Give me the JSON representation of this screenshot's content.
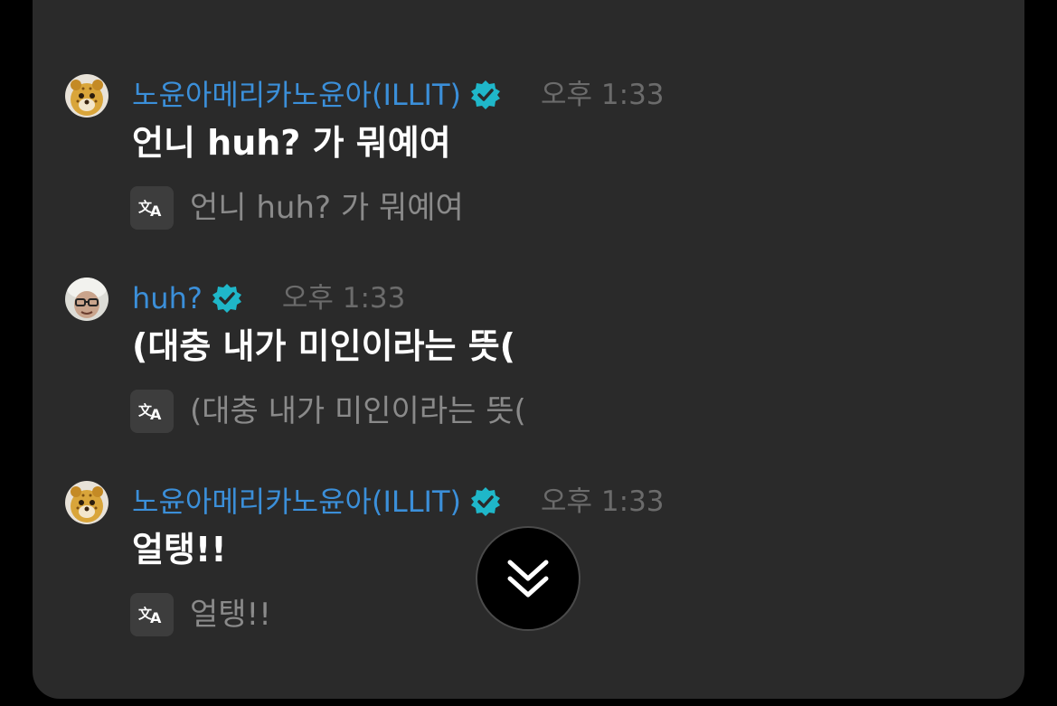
{
  "colors": {
    "background": "#000000",
    "panel": "#2a2a2a",
    "username_blue": "#3b8fd9",
    "verified_teal": "#1fb7c9",
    "timestamp_gray": "#6b6b6b",
    "translation_gray": "#8a8a8a",
    "message_white": "#ffffff"
  },
  "messages": [
    {
      "username": "노윤아메리카노윤아(ILLIT)",
      "verified_icon": "verified-badge-icon",
      "timestamp": "오후 1:33",
      "text": "언니 huh? 가 뭐예여",
      "translation": "언니 huh? 가 뭐예여",
      "avatar_icon": "cheetah-avatar"
    },
    {
      "username": "huh?",
      "verified_icon": "verified-badge-icon",
      "timestamp": "오후 1:33",
      "text": "(대충 내가 미인이라는 뜻(",
      "translation": "(대충 내가 미인이라는 뜻(",
      "avatar_icon": "person-avatar"
    },
    {
      "username": "노윤아메리카노윤아(ILLIT)",
      "verified_icon": "verified-badge-icon",
      "timestamp": "오후 1:33",
      "text": "얼탱!!",
      "translation": "얼탱!!",
      "avatar_icon": "cheetah-avatar"
    }
  ],
  "scroll_button": {
    "icon": "double-chevron-down-icon"
  }
}
